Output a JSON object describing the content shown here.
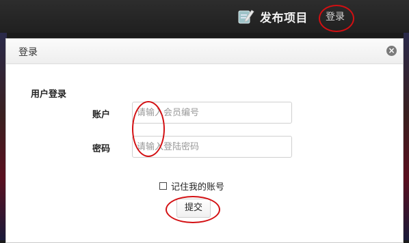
{
  "topbar": {
    "publish_label": "发布项目",
    "publish_icon": "edit-document-icon",
    "login_label": "登录"
  },
  "modal": {
    "title": "登录",
    "close_icon": "close-circle-icon",
    "section_title": "用户登录",
    "account": {
      "label": "账户",
      "value": "",
      "placeholder": "请输入会员编号"
    },
    "password": {
      "label": "密码",
      "value": "",
      "placeholder": "请输入登陆密码"
    },
    "remember_label": "记住我的账号",
    "remember_checked": false,
    "submit_label": "提交"
  },
  "annotations": {
    "color": "#d30f12"
  }
}
